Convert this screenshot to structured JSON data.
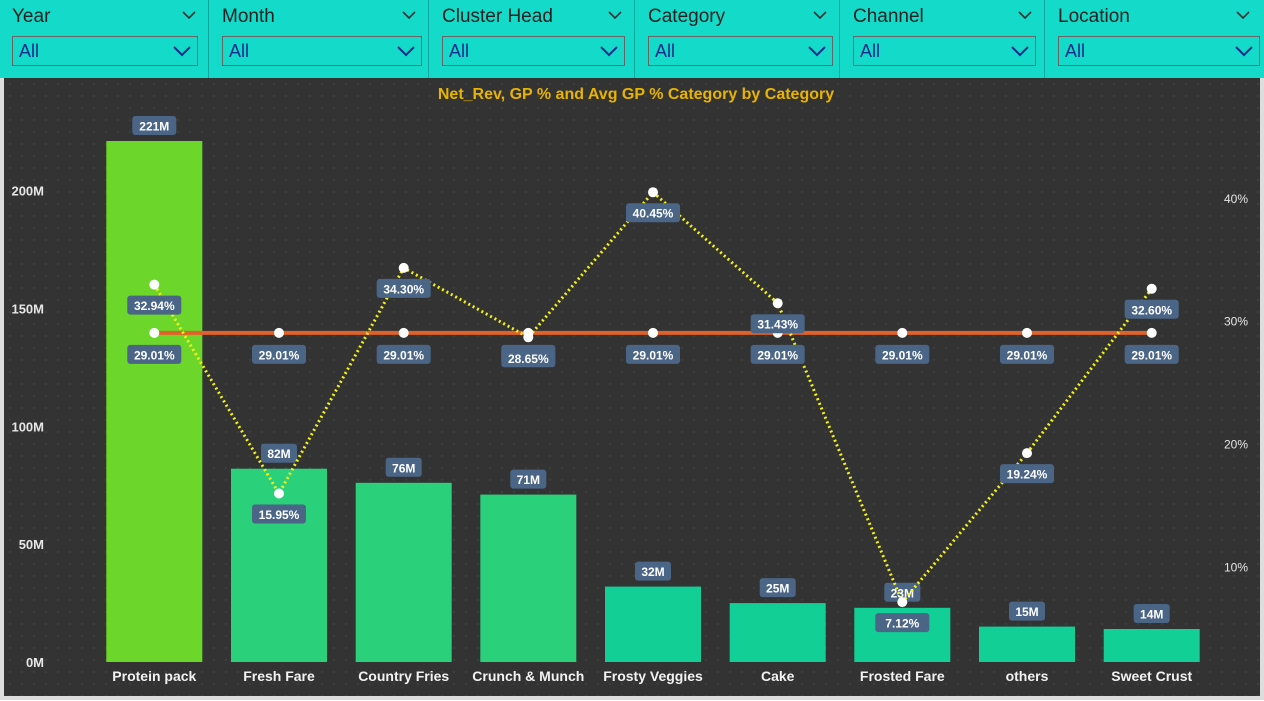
{
  "filters": [
    {
      "label": "Year",
      "value": "All"
    },
    {
      "label": "Month",
      "value": "All"
    },
    {
      "label": "Cluster Head",
      "value": "All"
    },
    {
      "label": "Category",
      "value": "All"
    },
    {
      "label": "Channel",
      "value": "All"
    },
    {
      "label": "Location",
      "value": "All"
    }
  ],
  "colors": {
    "filter_bg": "#13dac9",
    "chart_bg": "#333333",
    "title": "#e8b400",
    "bar_top": "#6dd62a",
    "bar_mid": "#2ad07a",
    "bar_low": "#12cf96",
    "gp_line": "#f2f21a",
    "avg_line": "#e0612a",
    "label_bg": "#4a6585"
  },
  "chart_data": {
    "type": "bar",
    "title": "Net_Rev, GP % and Avg GP % Category by Category",
    "categories": [
      "Protein pack",
      "Fresh Fare",
      "Country Fries",
      "Crunch & Munch",
      "Frosty Veggies",
      "Cake",
      "Frosted Fare",
      "others",
      "Sweet Crust"
    ],
    "series": [
      {
        "name": "Net_Rev",
        "type": "bar",
        "values": [
          221,
          82,
          76,
          71,
          32,
          25,
          23,
          15,
          14
        ],
        "value_labels": [
          "221M",
          "82M",
          "76M",
          "71M",
          "32M",
          "25M",
          "23M",
          "15M",
          "14M"
        ],
        "axis": "left"
      },
      {
        "name": "GP %",
        "type": "line",
        "values": [
          32.94,
          15.95,
          34.3,
          28.65,
          40.45,
          31.43,
          7.12,
          19.24,
          32.6
        ],
        "value_labels": [
          "32.94%",
          "15.95%",
          "34.30%",
          "28.65%",
          "40.45%",
          "31.43%",
          "7.12%",
          "19.24%",
          "32.60%"
        ],
        "axis": "right"
      },
      {
        "name": "Avg GP % Category",
        "type": "line",
        "values": [
          29.01,
          29.01,
          29.01,
          29.01,
          29.01,
          29.01,
          29.01,
          29.01,
          29.01
        ],
        "value_labels": [
          "29.01%",
          "29.01%",
          "29.01%",
          "29.01%",
          "29.01%",
          "29.01%",
          "29.01%",
          "29.01%",
          "29.01%"
        ],
        "axis": "right"
      }
    ],
    "y_left": {
      "ylim": [
        0,
        235
      ],
      "ticks": [
        0,
        50,
        100,
        150,
        200
      ],
      "tick_labels": [
        "0M",
        "50M",
        "100M",
        "150M",
        "200M"
      ]
    },
    "y_right": {
      "ylim": [
        2.25,
        47.3
      ],
      "ticks": [
        10,
        20,
        30,
        40
      ],
      "tick_labels": [
        "10%",
        "20%",
        "30%",
        "40%"
      ]
    },
    "grid": true
  }
}
